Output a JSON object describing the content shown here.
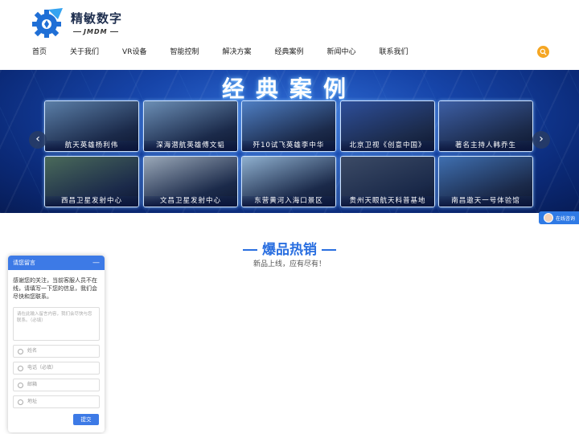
{
  "logo": {
    "name_cn": "精敏数字",
    "name_en": "JMDM"
  },
  "nav": {
    "items": [
      "首页",
      "关于我们",
      "VR设备",
      "智能控制",
      "解决方案",
      "经典案例",
      "新闻中心",
      "联系我们"
    ]
  },
  "search": {
    "icon": "search-icon",
    "color": "#f5a623"
  },
  "banner": {
    "title": "经典案例",
    "prev_arrow": "‹",
    "next_arrow": "›",
    "tiles": [
      {
        "caption": "航天英雄杨利伟",
        "color": "#5b7fa8"
      },
      {
        "caption": "深海潜航英雄傅文韬",
        "color": "#6c8fb6"
      },
      {
        "caption": "歼10试飞英雄李中华",
        "color": "#4f7fc4"
      },
      {
        "caption": "北京卫视《创意中国》",
        "color": "#2e4f9a"
      },
      {
        "caption": "著名主持人韩乔生",
        "color": "#3d5fa5"
      },
      {
        "caption": "西昌卫星发射中心",
        "color": "#4a6a5a"
      },
      {
        "caption": "文昌卫星发射中心",
        "color": "#9aa8b8"
      },
      {
        "caption": "东营黄河入海口景区",
        "color": "#8fb0cf"
      },
      {
        "caption": "贵州天眼航天科普基地",
        "color": "#3c4b66"
      },
      {
        "caption": "南昌遨天一号体验馆",
        "color": "#3f6fb0"
      }
    ]
  },
  "online_service": {
    "label": "在线咨询"
  },
  "hot": {
    "title": "爆品热销",
    "subtitle": "新品上线，应有尽有！"
  },
  "message_widget": {
    "title": "请您留言",
    "minimize": "—",
    "intro": "感谢您的关注，当前客服人员不在线，请填写一下您的信息，我们会尽快和您联系。",
    "message_placeholder": "请在此输入留言内容，我们会尽快与您联系。（必填）",
    "fields": [
      "姓名",
      "电话（必填）",
      "邮箱",
      "地址"
    ],
    "submit_label": "提交"
  },
  "colors": {
    "accent": "#2a6fe0",
    "widget_header": "#3d7ae6"
  }
}
